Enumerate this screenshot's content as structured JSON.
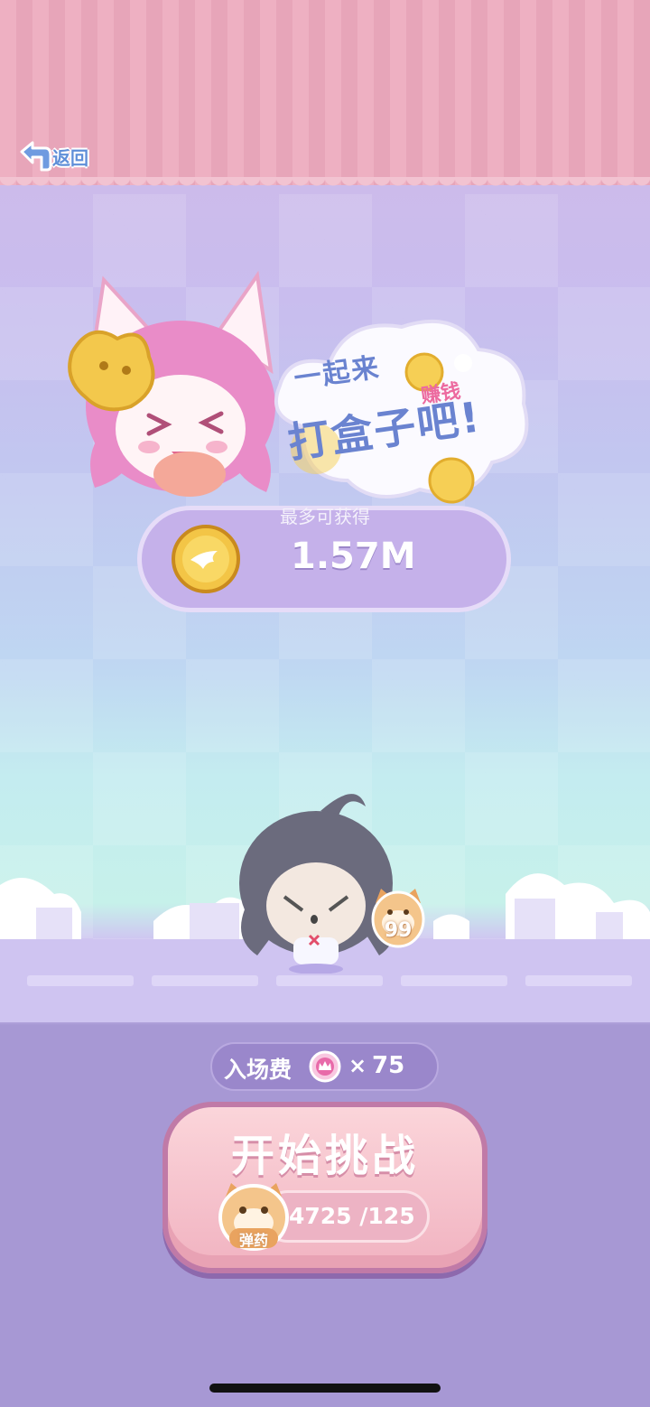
{
  "header": {
    "back_label": "返回"
  },
  "banner": {
    "line1": "一起来",
    "line2": "打盒子吧!",
    "tag": "赚钱"
  },
  "reward": {
    "title": "最多可获得",
    "value": "1.57M",
    "icon": "coin-icon"
  },
  "scene": {
    "ammo_badge_count": "99"
  },
  "entry": {
    "label": "入场费",
    "times": "×",
    "cost": "75",
    "icon": "crown-token-icon"
  },
  "start": {
    "label": "开始挑战",
    "ammo_value": "4725 /125",
    "ammo_icon_label": "弹药"
  },
  "colors": {
    "accent_pink": "#f1b3c1",
    "panel_purple": "#a798d4",
    "text_blue": "#6a83d0"
  }
}
